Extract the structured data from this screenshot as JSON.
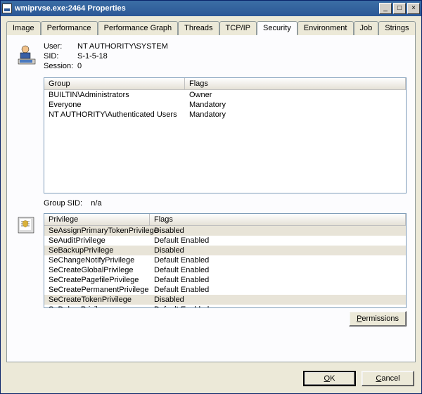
{
  "window": {
    "title": "wmiprvse.exe:2464 Properties"
  },
  "tabs": [
    "Image",
    "Performance",
    "Performance Graph",
    "Threads",
    "TCP/IP",
    "Security",
    "Environment",
    "Job",
    "Strings"
  ],
  "active_tab": "Security",
  "info": {
    "user_label": "User:",
    "user_value": "NT AUTHORITY\\SYSTEM",
    "sid_label": "SID:",
    "sid_value": "S-1-5-18",
    "session_label": "Session:",
    "session_value": "0"
  },
  "groups_header": {
    "a": "Group",
    "b": "Flags"
  },
  "groups": [
    {
      "a": "BUILTIN\\Administrators",
      "b": "Owner"
    },
    {
      "a": "Everyone",
      "b": "Mandatory"
    },
    {
      "a": "NT AUTHORITY\\Authenticated Users",
      "b": "Mandatory"
    }
  ],
  "group_sid": {
    "label": "Group SID:",
    "value": "n/a"
  },
  "priv_header": {
    "a": "Privilege",
    "b": "Flags"
  },
  "privileges": [
    {
      "a": "SeAssignPrimaryTokenPrivilege",
      "b": "Disabled",
      "alt": true
    },
    {
      "a": "SeAuditPrivilege",
      "b": "Default Enabled",
      "alt": false
    },
    {
      "a": "SeBackupPrivilege",
      "b": "Disabled",
      "alt": true
    },
    {
      "a": "SeChangeNotifyPrivilege",
      "b": "Default Enabled",
      "alt": false
    },
    {
      "a": "SeCreateGlobalPrivilege",
      "b": "Default Enabled",
      "alt": false
    },
    {
      "a": "SeCreatePagefilePrivilege",
      "b": "Default Enabled",
      "alt": false
    },
    {
      "a": "SeCreatePermanentPrivilege",
      "b": "Default Enabled",
      "alt": false
    },
    {
      "a": "SeCreateTokenPrivilege",
      "b": "Disabled",
      "alt": true
    },
    {
      "a": "SeDebugPrivilege",
      "b": "Default Enabled",
      "alt": false
    }
  ],
  "buttons": {
    "permissions": "Permissions",
    "ok": "OK",
    "cancel": "Cancel"
  }
}
